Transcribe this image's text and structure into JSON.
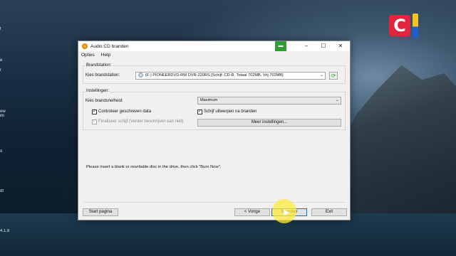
{
  "desktop": {
    "left_labels": [
      "t",
      "e",
      "r",
      "ew",
      "ilo",
      "o",
      "df",
      "4.1.8"
    ]
  },
  "window": {
    "title": "Audio CD branden",
    "controls": {
      "minimize": "–",
      "maximize": "☐",
      "close": "✕"
    }
  },
  "menu": {
    "items": [
      "Opties",
      "Help"
    ]
  },
  "brandstation": {
    "group_title": "Brandstation:",
    "label": "Kies brandstation:",
    "selected_drive": "(F:) PIONEERDVD-RW DVR-220RS [Schijf: CD-R, Totaal 702MB, Vrij 702MB]"
  },
  "instellingen": {
    "group_title": "Instellingen:",
    "speed_label": "Kies brandsnelheid:",
    "speed_value": "Maximum",
    "check_verify": {
      "label": "Controleer geschreven data",
      "checked": true
    },
    "check_eject": {
      "label": "Schijf uitwerpen na branden",
      "checked": true
    },
    "check_finalize": {
      "label": "Finaliseer schijf (Verder beschrijven kan niet)",
      "checked": true,
      "disabled": true
    },
    "more_settings_button": "Meer instellingen..."
  },
  "message": "Please insert a blank or rewritable disc in the drive, then click \"Burn Now\".",
  "footer": {
    "start_button": "Start pagina",
    "back_button": "< Vorige",
    "burn_button": "Branden",
    "exit_button": "Exit"
  }
}
